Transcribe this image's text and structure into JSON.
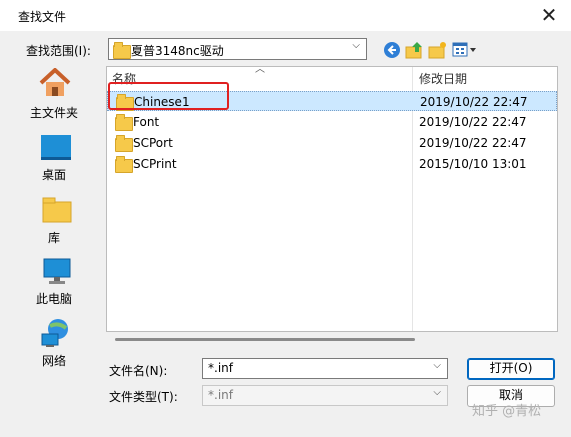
{
  "window": {
    "title": "查找文件",
    "close_glyph": "✕"
  },
  "lookin": {
    "label": "查找范围(I):",
    "value": "夏普3148nc驱动"
  },
  "toolbar": {
    "back": "back-icon",
    "up": "up-folder-icon",
    "newfolder": "new-folder-icon",
    "view": "view-menu-icon"
  },
  "places": [
    {
      "label": "主文件夹",
      "icon": "home-icon"
    },
    {
      "label": "桌面",
      "icon": "desktop-icon"
    },
    {
      "label": "库",
      "icon": "library-icon"
    },
    {
      "label": "此电脑",
      "icon": "computer-icon"
    },
    {
      "label": "网络",
      "icon": "network-icon"
    }
  ],
  "columns": {
    "name": "名称",
    "modified": "修改日期"
  },
  "files": [
    {
      "name": "Chinese1",
      "modified": "2019/10/22 22:47",
      "selected": true
    },
    {
      "name": "Font",
      "modified": "2019/10/22 22:47",
      "selected": false
    },
    {
      "name": "SCPort",
      "modified": "2019/10/22 22:47",
      "selected": false
    },
    {
      "name": "SCPrint",
      "modified": "2015/10/10 13:01",
      "selected": false
    }
  ],
  "filename": {
    "label": "文件名(N):",
    "value": "*.inf"
  },
  "filetype": {
    "label": "文件类型(T):",
    "value": "*.inf"
  },
  "buttons": {
    "open": "打开(O)",
    "cancel": "取消"
  },
  "watermark": "知乎 @青松",
  "colors": {
    "selection": "#cce8ff",
    "highlight_box": "#e02020",
    "accent": "#0067c0"
  }
}
